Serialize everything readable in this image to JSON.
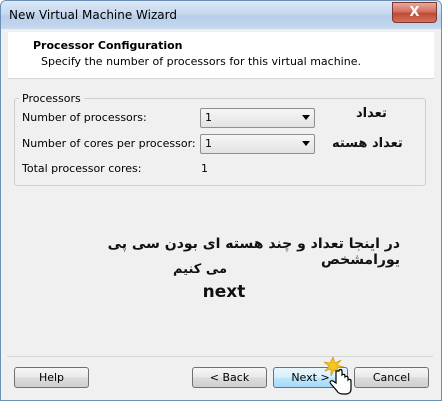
{
  "window": {
    "title": "New Virtual Machine Wizard",
    "close_glyph": "X"
  },
  "header": {
    "title": "Processor Configuration",
    "subtitle": "Specify the number of processors for this virtual machine."
  },
  "processors": {
    "group_label": "Processors",
    "num_processors_label": "Number of processors:",
    "num_processors_value": "1",
    "cores_per_processor_label": "Number of cores per processor:",
    "cores_per_processor_value": "1",
    "total_cores_label": "Total processor cores:",
    "total_cores_value": "1"
  },
  "annotations": {
    "count": "تعداد",
    "core_count": "تعداد هسته",
    "instruction_line1": "در اینجا تعداد و چند هسته ای بودن سی پی یورامشخص",
    "instruction_line2": "می کنیم",
    "instruction_line3": "next"
  },
  "footer": {
    "help_label": "Help",
    "back_label": "< Back",
    "next_label": "Next >",
    "cancel_label": "Cancel"
  },
  "colors": {
    "accent": "#3c7fb1",
    "close": "#c04a35",
    "titlebar": "#c6d9ef"
  },
  "icons": {
    "cursor": "hand-pointer-icon",
    "click": "click-burst-icon"
  }
}
